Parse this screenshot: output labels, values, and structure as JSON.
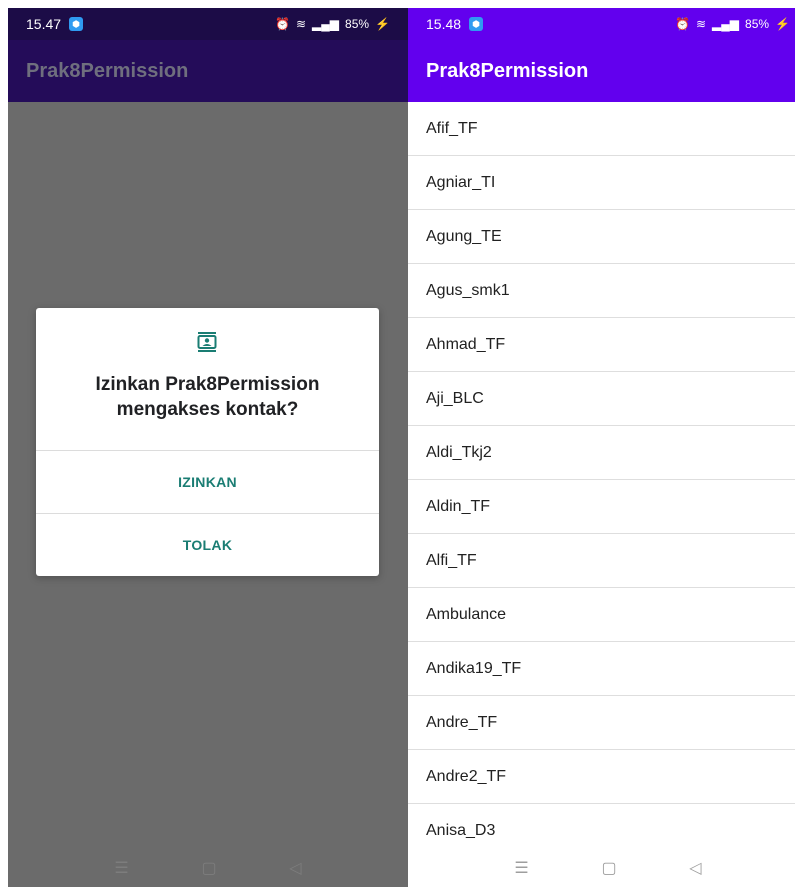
{
  "left": {
    "status": {
      "time": "15.47",
      "battery": "85%"
    },
    "appbar_title": "Prak8Permission",
    "dialog": {
      "title_line1": "Izinkan Prak8Permission",
      "title_line2": "mengakses kontak?",
      "allow_label": "IZINKAN",
      "deny_label": "TOLAK"
    }
  },
  "right": {
    "status": {
      "time": "15.48",
      "battery": "85%"
    },
    "appbar_title": "Prak8Permission",
    "contacts": [
      "Afif_TF",
      "Agniar_TI",
      "Agung_TE",
      "Agus_smk1",
      "Ahmad_TF",
      "Aji_BLC",
      "Aldi_Tkj2",
      "Aldin_TF",
      "Alfi_TF",
      "Ambulance",
      "Andika19_TF",
      "Andre_TF",
      "Andre2_TF",
      "Anisa_D3"
    ]
  },
  "colors": {
    "primary": "#6200ee",
    "dialog_button": "#1a7d73",
    "scrim": "#6b6b6b"
  },
  "icons": {
    "dialog": "contacts-icon",
    "nav": [
      "menu-icon",
      "home-icon",
      "back-icon"
    ]
  }
}
